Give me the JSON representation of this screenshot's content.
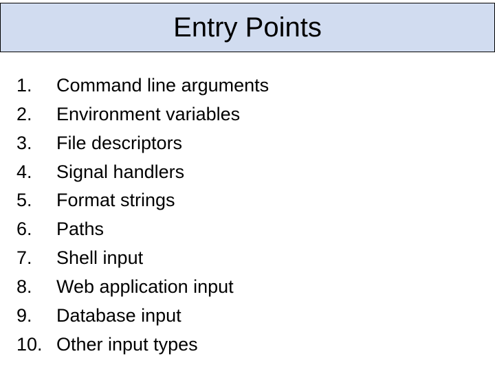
{
  "title": "Entry Points",
  "items": [
    {
      "num": "1.",
      "label": "Command line arguments"
    },
    {
      "num": "2.",
      "label": "Environment variables"
    },
    {
      "num": "3.",
      "label": "File descriptors"
    },
    {
      "num": "4.",
      "label": "Signal handlers"
    },
    {
      "num": "5.",
      "label": "Format strings"
    },
    {
      "num": "6.",
      "label": "Paths"
    },
    {
      "num": "7.",
      "label": "Shell input"
    },
    {
      "num": "8.",
      "label": "Web application input"
    },
    {
      "num": "9.",
      "label": "Database input"
    },
    {
      "num": "10.",
      "label": "Other input types"
    }
  ]
}
